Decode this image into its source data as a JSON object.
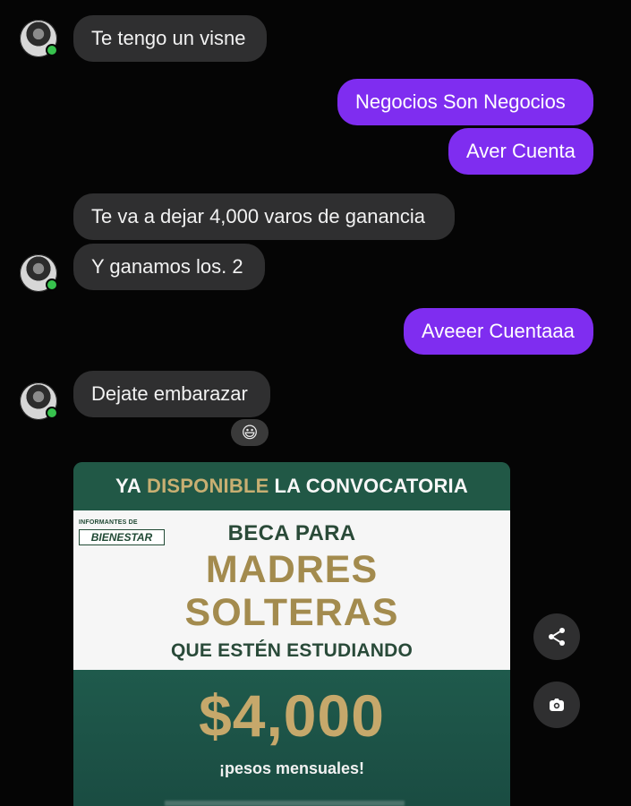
{
  "conversation": {
    "messages": [
      {
        "text": "Te tengo un visne"
      },
      {
        "text": "Negocios Son Negocios"
      },
      {
        "text": "Aver Cuenta"
      },
      {
        "text": "Te va a dejar 4,000 varos de ganancia"
      },
      {
        "text": "Y ganamos los. 2"
      },
      {
        "text": "Aveeer Cuentaaa"
      },
      {
        "text": "Dejate embarazar"
      }
    ],
    "reaction": "😃"
  },
  "shared_post": {
    "top_banner": {
      "part1": "YA",
      "part2": "DISPONIBLE",
      "part3": "LA CONVOCATORIA"
    },
    "badge": {
      "small_text": "INFORMANTES DE",
      "large_text": "BIENESTAR"
    },
    "beca_label": "BECA PARA",
    "headline_line1": "MADRES",
    "headline_line2": "SOLTERAS",
    "subheadline": "QUE ESTÉN ESTUDIANDO",
    "amount": "$4,000",
    "amount_note": "¡pesos mensuales!"
  },
  "actions": {
    "share_icon": "share-icon",
    "camera_icon": "camera-icon"
  }
}
